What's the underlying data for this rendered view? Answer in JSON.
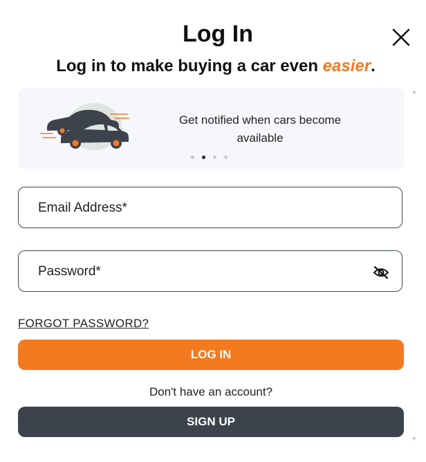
{
  "modal": {
    "title": "Log In",
    "subtitle_prefix": "Log in to make buying a car even ",
    "subtitle_accent": "easier",
    "subtitle_suffix": ".",
    "close_icon": "close-icon"
  },
  "carousel": {
    "slide_text": "Get notified when cars become available",
    "illustration_icon": "cars-icon",
    "total_slides": 4,
    "active_slide": 2
  },
  "form": {
    "email_placeholder": "Email Address*",
    "password_placeholder": "Password*",
    "password_toggle_icon": "eye-slash-icon",
    "forgot_password": "FORGOT PASSWORD?",
    "login_button": "LOG IN",
    "no_account_text": "Don't have an account?",
    "signup_button": "SIGN UP"
  },
  "colors": {
    "accent": "#f47a20",
    "dark_button": "#3c434c",
    "carousel_bg": "#f6f7fb"
  }
}
